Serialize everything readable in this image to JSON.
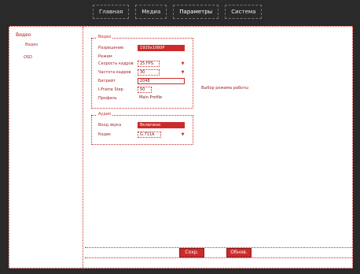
{
  "topnav": {
    "items": [
      "Главная",
      "Медиа",
      "Параметры",
      "Система"
    ],
    "active_index": 2
  },
  "sidebar": {
    "title": "Видео",
    "subtitle": "Видео",
    "item": "OSD"
  },
  "sections": {
    "video": {
      "title": "Видео",
      "rows": [
        {
          "label": "Разрешение",
          "value": "1920x1080P",
          "style": "dark"
        },
        {
          "label": "Режим",
          "value": ""
        },
        {
          "label": "Скорость кадров",
          "value": "25 FPS"
        },
        {
          "label": "Частота кадров",
          "value": "30"
        },
        {
          "label": "Битрейт",
          "value": "2048"
        },
        {
          "label": "I-Frame Step",
          "value": "50"
        },
        {
          "label": "Профиль",
          "value": "Main Profile"
        }
      ],
      "note": "Выбор режима работы"
    },
    "audio": {
      "title": "Аудио",
      "rows": [
        {
          "label": "Вход звука",
          "value": "Включено",
          "style": "dark"
        },
        {
          "label": "Кодек",
          "value": "G.711A"
        }
      ]
    }
  },
  "buttons": {
    "save": "Сохр.",
    "refresh": "Обнов."
  },
  "colors": {
    "accent": "#cc2b2b",
    "topbar": "#2a2a2a"
  }
}
